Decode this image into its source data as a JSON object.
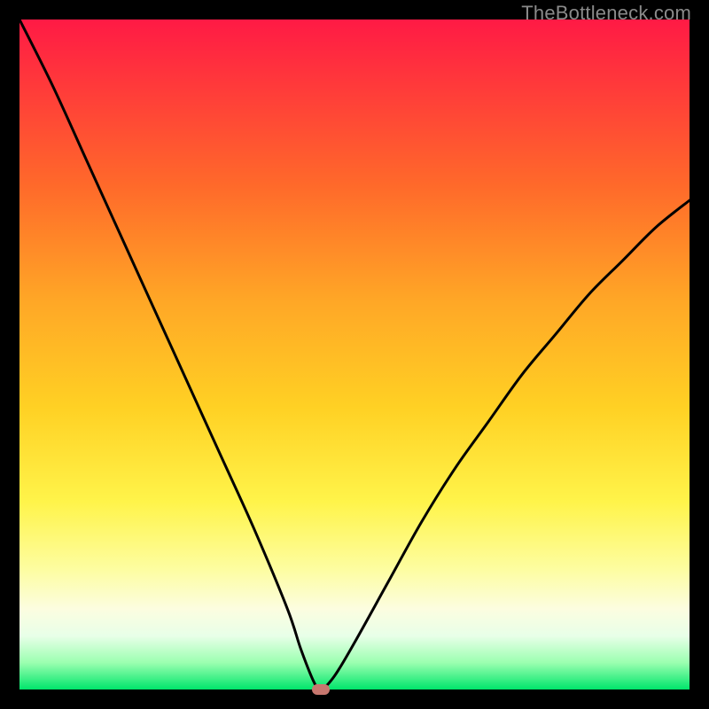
{
  "watermark": "TheBottleneck.com",
  "chart_data": {
    "type": "line",
    "title": "",
    "xlabel": "",
    "ylabel": "",
    "xlim": [
      0,
      100
    ],
    "ylim": [
      0,
      100
    ],
    "grid": false,
    "legend": false,
    "series": [
      {
        "name": "bottleneck-curve",
        "x": [
          0,
          5,
          10,
          15,
          20,
          25,
          30,
          35,
          40,
          42,
          44,
          45,
          47,
          50,
          55,
          60,
          65,
          70,
          75,
          80,
          85,
          90,
          95,
          100
        ],
        "values": [
          100,
          90,
          79,
          68,
          57,
          46,
          35,
          24,
          12,
          6,
          1,
          0,
          2,
          7,
          16,
          25,
          33,
          40,
          47,
          53,
          59,
          64,
          69,
          73
        ]
      }
    ],
    "marker": {
      "x": 45,
      "y": 0
    },
    "background_gradient": {
      "stops": [
        {
          "pos": 0,
          "color": "#ff1a45"
        },
        {
          "pos": 25,
          "color": "#ff6a2a"
        },
        {
          "pos": 58,
          "color": "#ffd124"
        },
        {
          "pos": 82,
          "color": "#fdfda0"
        },
        {
          "pos": 100,
          "color": "#00e56b"
        }
      ]
    }
  }
}
